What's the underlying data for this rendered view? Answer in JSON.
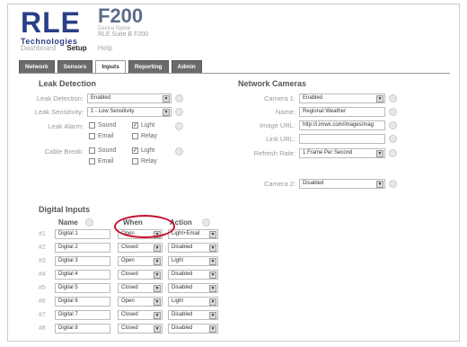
{
  "header": {
    "logo_main": "RLE",
    "logo_sub": "Technologies",
    "model": "F200",
    "device_label": "Device Name",
    "device_name": "RLE Suite B F200",
    "nav": [
      "Dashboard",
      "Setup",
      "Help"
    ]
  },
  "tabs": [
    "Network",
    "Sensors",
    "Inputs",
    "Reporting",
    "Admin"
  ],
  "leak": {
    "title": "Leak Detection",
    "detection_label": "Leak Detection:",
    "detection_value": "Enabled",
    "sensitivity_label": "Leak Sensitivity:",
    "sensitivity_value": "1 - Low Sensitivity",
    "alarm_label": "Leak Alarm:",
    "cable_label": "Cable Break:",
    "opt_sound": "Sound",
    "opt_light": "Light",
    "opt_email": "Email",
    "opt_relay": "Relay"
  },
  "cameras": {
    "title": "Network Cameras",
    "camera1_label": "Camera 1:",
    "camera1_value": "Enabled",
    "name_label": "Name:",
    "name_value": "Regional Weather",
    "image_label": "Image URL:",
    "image_value": "http://i.imwx.com/images/mag",
    "link_label": "Link URL:",
    "link_value": "",
    "refresh_label": "Refresh Rate:",
    "refresh_value": "1 Frame Per Second",
    "camera2_label": "Camera 2:",
    "camera2_value": "Disabled"
  },
  "digital": {
    "title": "Digital Inputs",
    "col_name": "Name",
    "col_when": "When",
    "col_action": "Action",
    "rows": [
      {
        "num": "#1",
        "name": "Digital 1",
        "when": "Open",
        "action": "Light+Email"
      },
      {
        "num": "#2",
        "name": "Digital 2",
        "when": "Closed",
        "action": "Disabled"
      },
      {
        "num": "#3",
        "name": "Digital 3",
        "when": "Open",
        "action": "Light"
      },
      {
        "num": "#4",
        "name": "Digital 4",
        "when": "Closed",
        "action": "Disabled"
      },
      {
        "num": "#5",
        "name": "Digital 5",
        "when": "Closed",
        "action": "Disabled"
      },
      {
        "num": "#6",
        "name": "Digital 6",
        "when": "Open",
        "action": "Light"
      },
      {
        "num": "#7",
        "name": "Digital 7",
        "when": "Closed",
        "action": "Disabled"
      },
      {
        "num": "#8",
        "name": "Digital 8",
        "when": "Closed",
        "action": "Disabled"
      }
    ]
  },
  "colors": {
    "brand": "#2a3f86",
    "annotation": "#c8102e",
    "tab_bg": "#6b6b6b"
  }
}
